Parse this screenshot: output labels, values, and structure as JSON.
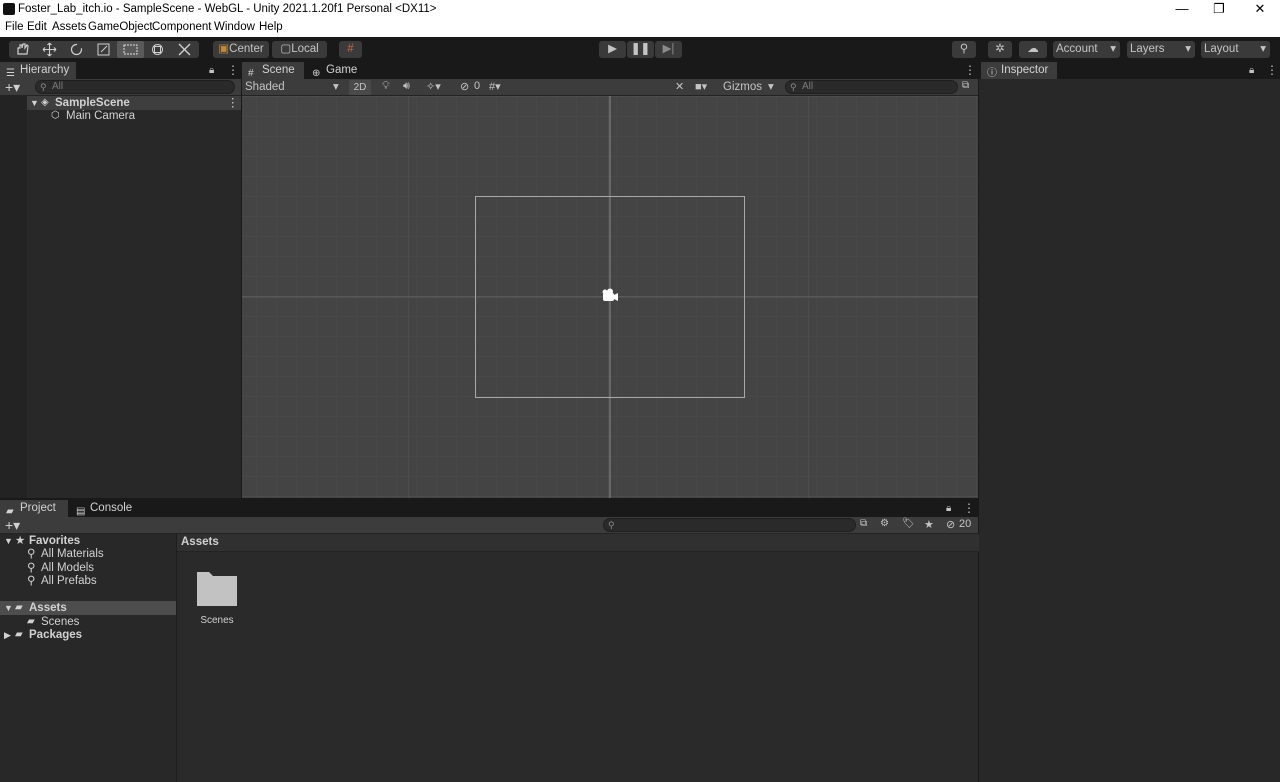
{
  "window": {
    "title": "Foster_Lab_itch.io - SampleScene - WebGL - Unity 2021.1.20f1 Personal <DX11>",
    "minimize_glyph": "—",
    "restore_glyph": "❐",
    "close_glyph": "✕"
  },
  "menu": [
    "File",
    "Edit",
    "Assets",
    "GameObject",
    "Component",
    "Window",
    "Help"
  ],
  "toolbar": {
    "tools": [
      "hand-tool",
      "move-tool",
      "rotate-tool",
      "scale-tool",
      "rect-tool",
      "transform-tool",
      "custom-tool"
    ],
    "active_tool": "rect-tool",
    "pivot_label": "Center",
    "space_label": "Local",
    "account_label": "Account",
    "layers_label": "Layers",
    "layout_label": "Layout"
  },
  "hierarchy": {
    "tab_label": "Hierarchy",
    "search_placeholder": "All",
    "scene_name": "SampleScene",
    "objects": [
      "Main Camera"
    ]
  },
  "scene_view": {
    "tabs": [
      "Scene",
      "Game"
    ],
    "active_tab": "Scene",
    "draw_mode": "Shaded",
    "mode_2d_label": "2D",
    "hidden_count": "0",
    "gizmos_label": "Gizmos",
    "search_placeholder": "All"
  },
  "inspector": {
    "tab_label": "Inspector"
  },
  "project": {
    "tabs": [
      "Project",
      "Console"
    ],
    "active_tab": "Project",
    "favorites_label": "Favorites",
    "favorites": [
      "All Materials",
      "All Models",
      "All Prefabs"
    ],
    "assets_label": "Assets",
    "asset_folders": [
      "Scenes"
    ],
    "packages_label": "Packages",
    "breadcrumb": "Assets",
    "items": [
      {
        "name": "Scenes",
        "icon": "folder-icon"
      }
    ],
    "hidden_packages_count": "20"
  },
  "colors": {
    "accent_scene_frame": "#9a9a9a",
    "panel_bg": "#282828",
    "selection_bg": "#4d4d4d"
  }
}
